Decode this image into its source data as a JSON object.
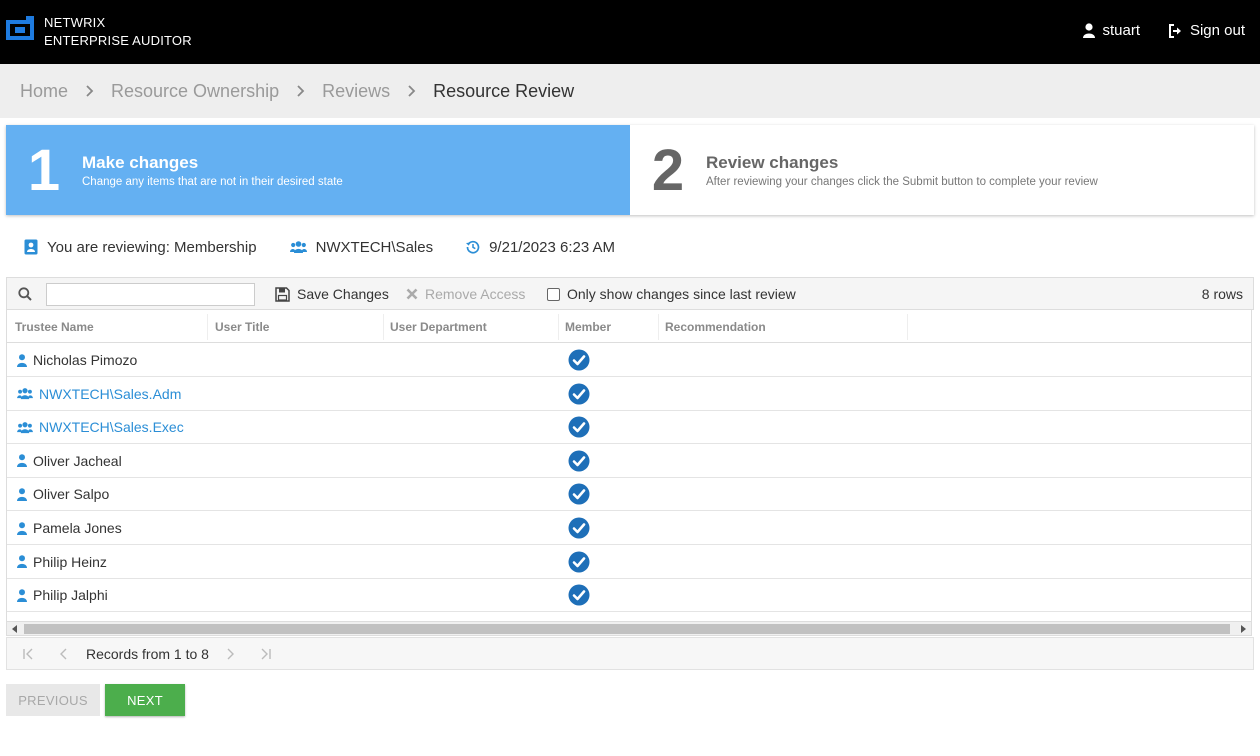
{
  "header": {
    "brand_line1": "NETWRIX",
    "brand_line2": "ENTERPRISE AUDITOR",
    "user": "stuart",
    "signout": "Sign out"
  },
  "breadcrumb": [
    "Home",
    "Resource Ownership",
    "Reviews",
    "Resource Review"
  ],
  "steps": [
    {
      "number": "1",
      "title": "Make changes",
      "desc": "Change any items that are not in their desired state",
      "active": true
    },
    {
      "number": "2",
      "title": "Review changes",
      "desc": "After reviewing your changes click the Submit button to complete your review",
      "active": false
    }
  ],
  "info": {
    "reviewing": "You are reviewing: Membership",
    "resource": "NWXTECH\\Sales",
    "timestamp": "9/21/2023 6:23 AM"
  },
  "toolbar": {
    "search_value": "",
    "save_label": "Save Changes",
    "remove_label": "Remove Access",
    "only_changes_label": "Only show changes since last review",
    "row_count": "8 rows"
  },
  "table": {
    "columns": [
      "Trustee Name",
      "User Title",
      "User Department",
      "Member",
      "Recommendation"
    ],
    "rows": [
      {
        "name": "Nicholas Pimozo",
        "type": "person",
        "member": true
      },
      {
        "name": "NWXTECH\\Sales.Adm",
        "type": "group",
        "member": true
      },
      {
        "name": "NWXTECH\\Sales.Exec",
        "type": "group",
        "member": true
      },
      {
        "name": "Oliver Jacheal",
        "type": "person",
        "member": true
      },
      {
        "name": "Oliver Salpo",
        "type": "person",
        "member": true
      },
      {
        "name": "Pamela Jones",
        "type": "person",
        "member": true
      },
      {
        "name": "Philip Heinz",
        "type": "person",
        "member": true
      },
      {
        "name": "Philip Jalphi",
        "type": "person",
        "member": true
      }
    ]
  },
  "pager": {
    "text": "Records from 1 to 8"
  },
  "buttons": {
    "previous": "PREVIOUS",
    "next": "NEXT"
  },
  "colors": {
    "active_step": "#64b0f2",
    "accent_blue": "#2b8ed6",
    "check_blue": "#1e6fb8",
    "next_green": "#4cae4c"
  }
}
